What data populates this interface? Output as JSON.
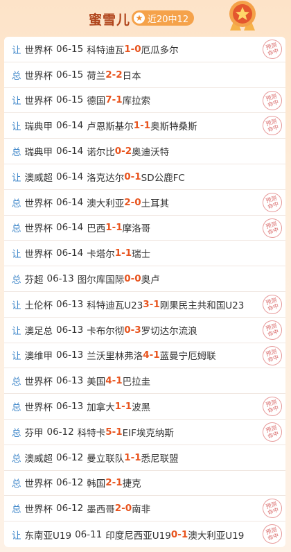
{
  "header": {
    "title": "蜜雪儿",
    "badge": "近20中12",
    "stamp_line1": "预测",
    "stamp_line2": "命中"
  },
  "rows": [
    {
      "type": "让",
      "league": "世界杯",
      "date": "06-15",
      "home": "科特迪瓦",
      "hs": "1",
      "sep": " - ",
      "as": "0",
      "away": "厄瓜多尔",
      "hit": true
    },
    {
      "type": "总",
      "league": "世界杯",
      "date": "06-15",
      "home": "荷兰",
      "hs": "2",
      "sep": " - ",
      "as": "2",
      "away": "日本",
      "hit": false
    },
    {
      "type": "让",
      "league": "世界杯",
      "date": "06-15",
      "home": "德国",
      "hs": "7",
      "sep": " - ",
      "as": "1",
      "away": "库拉索",
      "hit": true
    },
    {
      "type": "让",
      "league": "瑞典甲",
      "date": "06-14",
      "home": "卢恩斯基尔",
      "hs": "1",
      "sep": " - ",
      "as": "1",
      "away": "奥斯特桑斯",
      "hit": true
    },
    {
      "type": "总",
      "league": "瑞典甲",
      "date": "06-14",
      "home": "诺尔比",
      "hs": "0",
      "sep": " - ",
      "as": "2",
      "away": "奥迪沃特",
      "hit": false
    },
    {
      "type": "让",
      "league": "澳威超",
      "date": "06-14",
      "home": "洛克达尔",
      "hs": "0",
      "sep": " - ",
      "as": "1",
      "away": "SD公鹿FC",
      "hit": false
    },
    {
      "type": "总",
      "league": "世界杯",
      "date": "06-14",
      "home": "澳大利亚",
      "hs": "2",
      "sep": " - ",
      "as": "0",
      "away": "土耳其",
      "hit": true
    },
    {
      "type": "总",
      "league": "世界杯",
      "date": "06-14",
      "home": "巴西",
      "hs": "1",
      "sep": " - ",
      "as": "1",
      "away": "摩洛哥",
      "hit": true
    },
    {
      "type": "让",
      "league": "世界杯",
      "date": "06-14",
      "home": "卡塔尔",
      "hs": "1",
      "sep": " - ",
      "as": "1",
      "away": "瑞士",
      "hit": false
    },
    {
      "type": "总",
      "league": "芬超",
      "date": "06-13",
      "home": "图尔库国际",
      "hs": "0",
      "sep": " - ",
      "as": "0",
      "away": "奥卢",
      "hit": false
    },
    {
      "type": "让",
      "league": "土伦杯",
      "date": "06-13",
      "home": "科特迪瓦U23",
      "hs": "3",
      "sep": " - ",
      "as": "1",
      "away": "刚果民主共和国U23",
      "hit": true
    },
    {
      "type": "让",
      "league": "澳足总",
      "date": "06-13",
      "home": "卡布尔彻",
      "hs": "0",
      "sep": " - ",
      "as": "3",
      "away": "罗切达尔流浪",
      "hit": true
    },
    {
      "type": "让",
      "league": "澳维甲",
      "date": "06-13",
      "home": "兰沃里林弗洛",
      "hs": "4",
      "sep": " - ",
      "as": "1",
      "away": "蓝曼宁厄姆联",
      "hit": true
    },
    {
      "type": "总",
      "league": "世界杯",
      "date": "06-13",
      "home": "美国",
      "hs": "4",
      "sep": " - ",
      "as": "1",
      "away": "巴拉圭",
      "hit": false
    },
    {
      "type": "总",
      "league": "世界杯",
      "date": "06-13",
      "home": "加拿大",
      "hs": "1",
      "sep": " - ",
      "as": "1",
      "away": "波黑",
      "hit": true
    },
    {
      "type": "总",
      "league": "芬甲",
      "date": "06-12",
      "home": "科特卡",
      "hs": "5",
      "sep": " - ",
      "as": "1",
      "away": "EIF埃克纳斯",
      "hit": true
    },
    {
      "type": "总",
      "league": "澳威超",
      "date": "06-12",
      "home": "曼立联队",
      "hs": "1",
      "sep": " - ",
      "as": "1",
      "away": "悉尼联盟",
      "hit": false
    },
    {
      "type": "总",
      "league": "世界杯",
      "date": "06-12",
      "home": "韩国",
      "hs": "2",
      "sep": " - ",
      "as": "1",
      "away": "捷克",
      "hit": false
    },
    {
      "type": "总",
      "league": "世界杯",
      "date": "06-12",
      "home": "墨西哥",
      "hs": "2",
      "sep": " - ",
      "as": "0",
      "away": "南非",
      "hit": true
    },
    {
      "type": "让",
      "league": "东南亚U19",
      "date": "06-11",
      "home": "印度尼西亚U19",
      "hs": "0",
      "sep": " - ",
      "as": "1",
      "away": "澳大利亚U19",
      "hit": true
    }
  ]
}
